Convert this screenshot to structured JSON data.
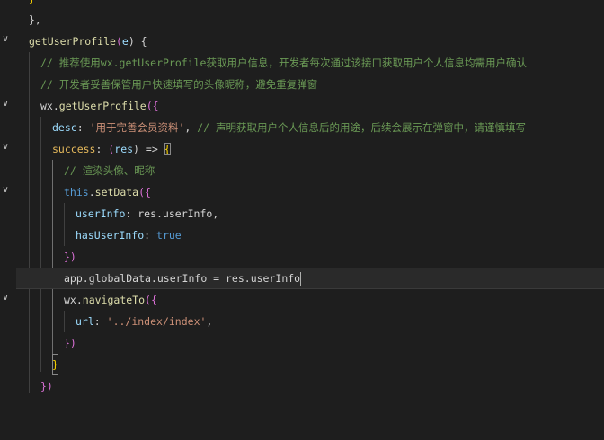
{
  "editor": {
    "lines": [
      {
        "text": "}"
      },
      {
        "text": "},"
      },
      {
        "fn": "getUserProfile",
        "paren_open": "(",
        "arg": "e",
        "rest": ") {"
      },
      {
        "comment": "// 推荐使用wx.getUserProfile获取用户信息，开发者每次通过该接口获取用户个人信息均需用户确认"
      },
      {
        "comment": "// 开发者妥善保管用户快速填写的头像昵称，避免重复弹窗"
      },
      {
        "obj": "wx.",
        "fn": "getUserProfile",
        "rest": "({"
      },
      {
        "prop": "desc",
        "colon": ": ",
        "str": "'用于完善会员资料'",
        "comma": ", ",
        "comment": "// 声明获取用户个人信息后的用途，后续会展示在弹窗中，请谨慎填写"
      },
      {
        "prop": "success",
        "colon": ": ",
        "paren": "(",
        "arg": "res",
        "arrow": ") => ",
        "brace": "{"
      },
      {
        "comment": "// 渲染头像、昵称"
      },
      {
        "this": "this",
        "dot": ".",
        "fn": "setData",
        "rest": "({"
      },
      {
        "prop": "userInfo",
        "rest": ": res.userInfo,"
      },
      {
        "prop": "hasUserInfo",
        "colon": ": ",
        "bool": "true"
      },
      {
        "text": "})"
      },
      {
        "text": "app.globalData.userInfo = res.userInfo"
      },
      {
        "obj": "wx.",
        "fn": "navigateTo",
        "rest": "({"
      },
      {
        "prop": "url",
        "colon": ": ",
        "str": "'../index/index'",
        "comma": ","
      },
      {
        "text": "})"
      },
      {
        "text": "}"
      },
      {
        "text": "})"
      }
    ]
  }
}
